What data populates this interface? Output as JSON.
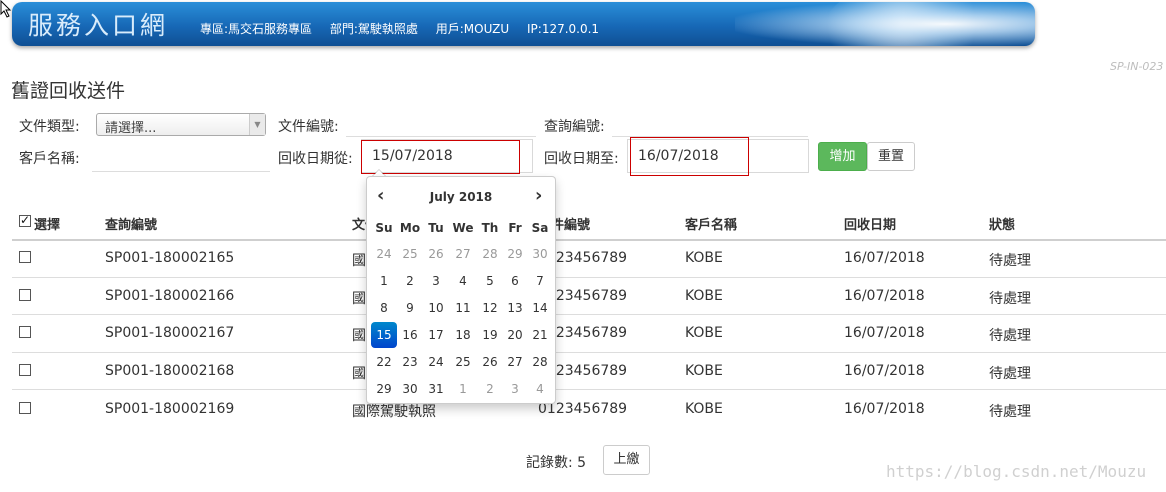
{
  "header": {
    "title": "服務入口網",
    "info": {
      "zone": "專區:馬交石服務專區",
      "dept": "部門:駕駛執照處",
      "user": "用戶:MOUZU",
      "ip": "IP:127.0.0.1"
    }
  },
  "page": {
    "code": "SP-IN-023",
    "title": "舊證回收送件"
  },
  "filters": {
    "doc_type_label": "文件類型:",
    "doc_type_value": "請選擇...",
    "doc_no_label": "文件編號:",
    "query_no_label": "查詢編號:",
    "client_label": "客戶名稱:",
    "date_from_label": "回收日期從:",
    "date_from_value": "15/07/2018",
    "date_to_label": "回收日期至:",
    "date_to_value": "16/07/2018",
    "add_button": "增加",
    "reset_button": "重置"
  },
  "table": {
    "columns": [
      "選擇",
      "查詢編號",
      "文件類型",
      "文件編號",
      "客戶名稱",
      "回收日期",
      "狀態"
    ],
    "rows": [
      [
        "",
        "SP001-180002165",
        "國際駕駛執照",
        "0123456789",
        "KOBE",
        "16/07/2018",
        "待處理"
      ],
      [
        "",
        "SP001-180002166",
        "國際駕駛執照",
        "0123456789",
        "KOBE",
        "16/07/2018",
        "待處理"
      ],
      [
        "",
        "SP001-180002167",
        "國際駕駛執照",
        "0123456789",
        "KOBE",
        "16/07/2018",
        "待處理"
      ],
      [
        "",
        "SP001-180002168",
        "國際駕駛執照",
        "0123456789",
        "KOBE",
        "16/07/2018",
        "待處理"
      ],
      [
        "",
        "SP001-180002169",
        "國際駕駛執照",
        "0123456789",
        "KOBE",
        "16/07/2018",
        "待處理"
      ]
    ]
  },
  "datepicker": {
    "month_label": "July 2018",
    "prev": "‹",
    "next": "›",
    "weekdays": [
      "Su",
      "Mo",
      "Tu",
      "We",
      "Th",
      "Fr",
      "Sa"
    ],
    "weeks": [
      [
        "24",
        "25",
        "26",
        "27",
        "28",
        "29",
        "30"
      ],
      [
        "1",
        "2",
        "3",
        "4",
        "5",
        "6",
        "7"
      ],
      [
        "8",
        "9",
        "10",
        "11",
        "12",
        "13",
        "14"
      ],
      [
        "15",
        "16",
        "17",
        "18",
        "19",
        "20",
        "21"
      ],
      [
        "22",
        "23",
        "24",
        "25",
        "26",
        "27",
        "28"
      ],
      [
        "29",
        "30",
        "31",
        "1",
        "2",
        "3",
        "4"
      ]
    ],
    "selected": "15"
  },
  "footer": {
    "records": "記錄數: 5",
    "prev_button": "上繳"
  },
  "watermark": "https://blog.csdn.net/Mouzu",
  "colors": {
    "banner": "#1768b6",
    "add_button": "#5cb85c",
    "selected_day": "#0a64c7",
    "highlight_frame": "#cc0000"
  }
}
